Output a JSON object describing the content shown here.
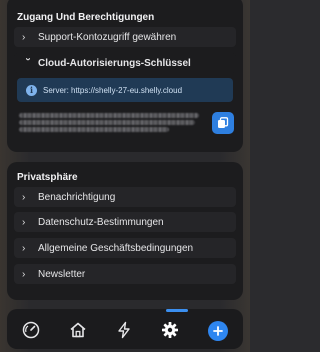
{
  "access_section": {
    "title": "Zugang Und Berechtigungen",
    "support_label": "Support-Kontozugriff gewähren",
    "cloud_label": "Cloud-Autorisierungs-Schlüssel",
    "server_text": "Server: https://shelly-27-eu.shelly.cloud"
  },
  "privacy_section": {
    "title": "Privatsphäre",
    "items": [
      {
        "label": "Benachrichtigung"
      },
      {
        "label": "Datenschutz-Bestimmungen"
      },
      {
        "label": "Allgemeine Geschäftsbedingungen"
      },
      {
        "label": "Newsletter"
      }
    ]
  },
  "tabbar": {
    "tabs": [
      {
        "icon": "gauge-icon"
      },
      {
        "icon": "home-icon"
      },
      {
        "icon": "bolt-icon"
      },
      {
        "icon": "gear-icon",
        "active": true
      }
    ],
    "fab_icon": "plus-icon"
  },
  "colors": {
    "accent": "#2e86f0",
    "card_bg": "#1c1c1e",
    "info_bg": "#203a55"
  }
}
